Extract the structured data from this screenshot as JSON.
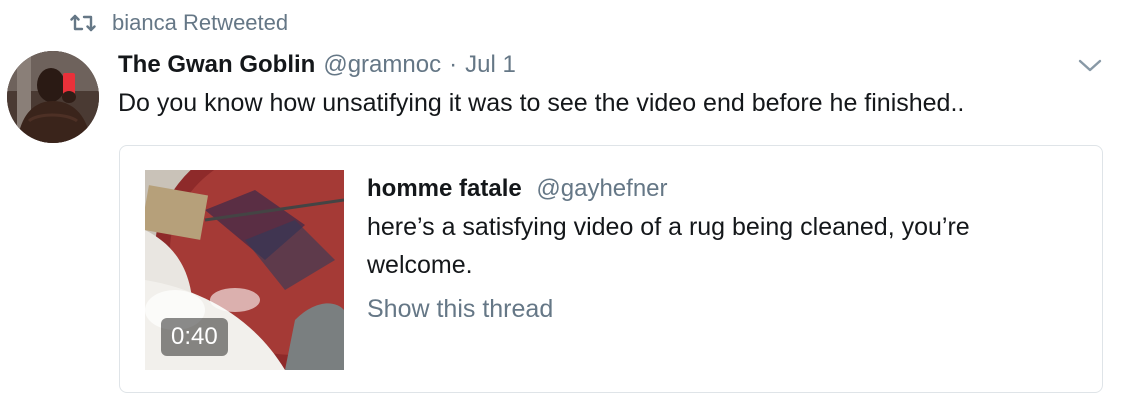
{
  "retweet": {
    "text": "bianca Retweeted",
    "icon": "retweet-icon"
  },
  "tweet": {
    "display_name": "The Gwan Goblin",
    "handle": "@gramnoc",
    "separator": "·",
    "date": "Jul 1",
    "text": "Do you know how unsatifying it was to see the video end before he finished..",
    "menu_icon": "chevron-down-icon"
  },
  "quote": {
    "display_name": "homme fatale",
    "handle": "@gayhefner",
    "text": "here’s a satisfying video of a rug being cleaned, you’re welcome.",
    "show_thread": "Show this thread",
    "video_duration": "0:40"
  },
  "colors": {
    "primary_text": "#14171a",
    "secondary_text": "#657786",
    "card_border": "#dfe4e8"
  }
}
